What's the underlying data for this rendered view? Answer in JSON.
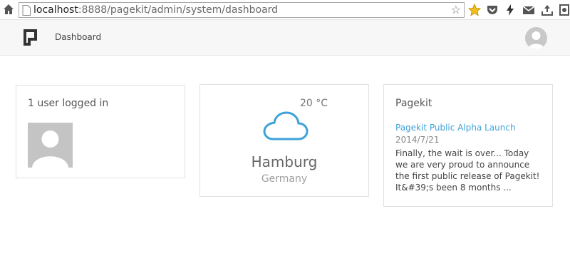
{
  "browser": {
    "url_host": "localhost",
    "url_rest": ":8888/pagekit/admin/system/dashboard"
  },
  "nav": {
    "dashboard_label": "Dashboard"
  },
  "users_widget": {
    "title": "1 user logged in"
  },
  "weather_widget": {
    "temperature": "20 °C",
    "city": "Hamburg",
    "country": "Germany"
  },
  "feed_widget": {
    "title": "Pagekit",
    "post_title": "Pagekit Public Alpha Launch",
    "post_date": "2014/7/21",
    "post_excerpt": "Finally, the wait is over... Today we are very proud to announce the first public release of Pagekit! It&#39;s been 8 months ..."
  },
  "colors": {
    "link": "#3ea2da",
    "cloud": "#3ea2da"
  }
}
